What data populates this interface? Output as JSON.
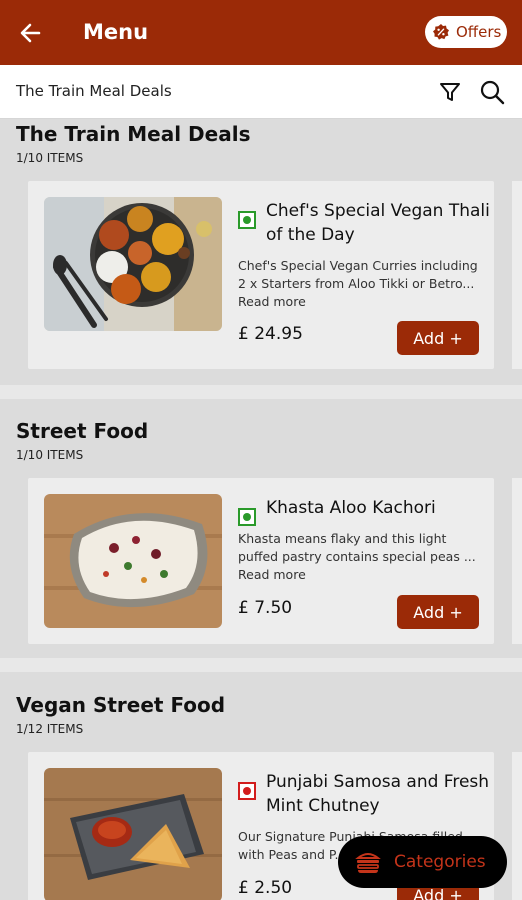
{
  "appbar": {
    "title": "Menu",
    "offers_label": "Offers"
  },
  "searchbar": {
    "title": "The Train Meal Deals"
  },
  "sections": [
    {
      "title": "The Train Meal Deals",
      "count": "1/10 ITEMS",
      "item": {
        "name": "Chef's Special Vegan Thali of the Day",
        "desc_line1": "Chef's Special Vegan Curries including",
        "desc_line2": "2 x Starters from Aloo Tikki or Betro...",
        "read_more": "Read more",
        "price": "£ 24.95",
        "add_label": "Add +",
        "diet": "veg"
      }
    },
    {
      "title": "Street Food",
      "count": "1/10 ITEMS",
      "item": {
        "name": "Khasta Aloo Kachori",
        "desc_line1": "Khasta means flaky and this light",
        "desc_line2": "puffed pastry contains special peas ...",
        "read_more": "Read more",
        "price": "£ 7.50",
        "add_label": "Add +",
        "diet": "veg"
      }
    },
    {
      "title": "Vegan Street Food",
      "count": "1/12 ITEMS",
      "item": {
        "name": "Punjabi Samosa and Fresh Mint Chutney",
        "desc_line1": "Our Signature Punjabi Samosa filled",
        "desc_line2": "with Peas and P...",
        "price": "£ 2.50",
        "add_label": "Add +",
        "diet": "nonveg"
      }
    }
  ],
  "fab": {
    "label": "Categories"
  },
  "colors": {
    "brand": "#9b2a07",
    "veg": "#2a9a2a",
    "nonveg": "#d21d1d",
    "fab_text": "#c4341a"
  }
}
